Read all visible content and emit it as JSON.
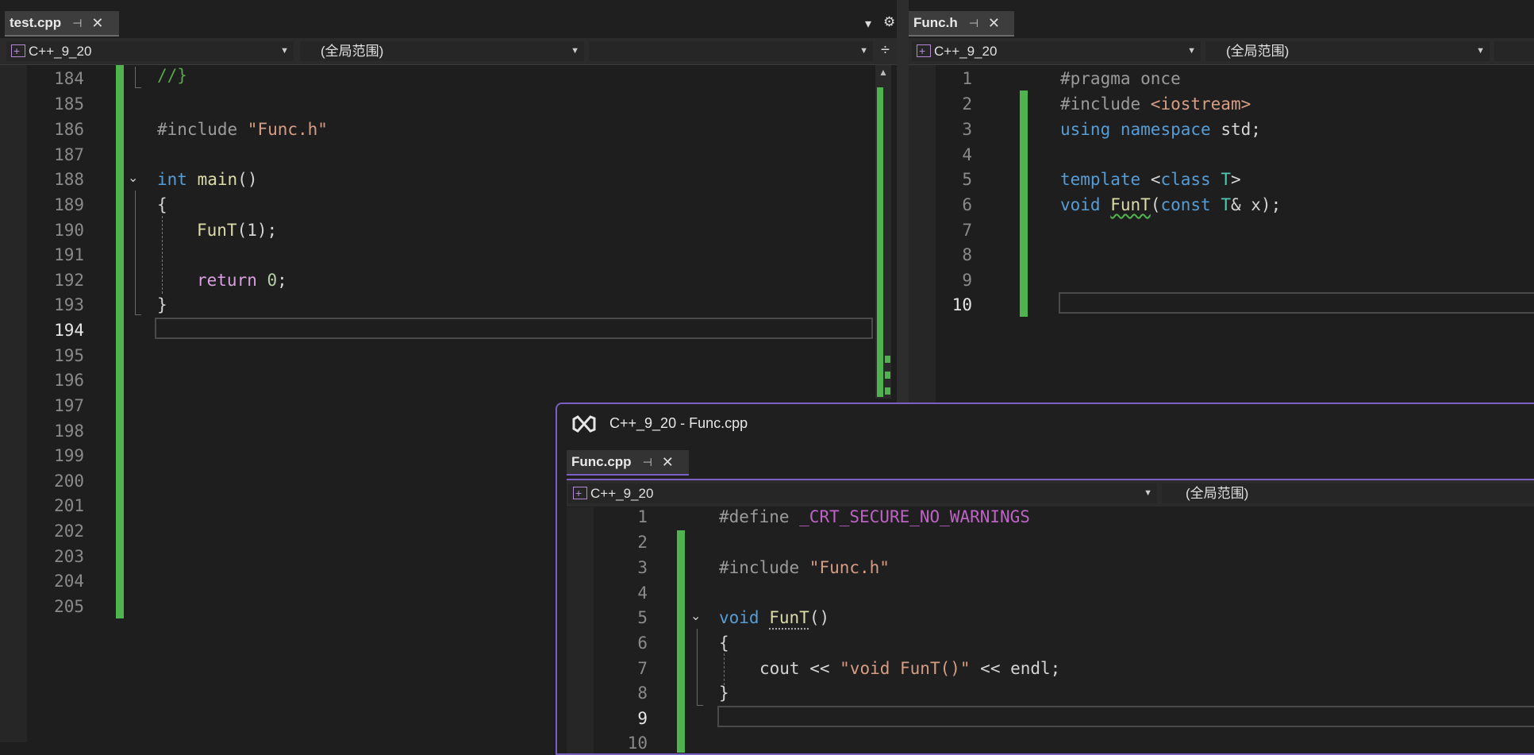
{
  "left_pane": {
    "tab": {
      "label": "test.cpp",
      "pin": "⊣",
      "close": "✕"
    },
    "nav": {
      "project": "C++_9_20",
      "scope": "(全局范围)",
      "member": ""
    },
    "lines": [
      "184",
      "185",
      "186",
      "187",
      "188",
      "189",
      "190",
      "191",
      "192",
      "193",
      "194",
      "195",
      "196",
      "197",
      "198",
      "199",
      "200",
      "201",
      "202",
      "203",
      "204",
      "205"
    ],
    "current_line": "194",
    "code": {
      "l184": "//}",
      "l186_pre": "#include ",
      "l186_str": "\"Func.h\"",
      "l188_kw": "int",
      "l188_fn": "main",
      "l188_rest": "()",
      "l189": "{",
      "l190_fn": "FunT",
      "l190_rest": "(1);",
      "l192_kw": "return",
      "l192_num": "0",
      "l192_rest": ";",
      "l193": "}"
    }
  },
  "right_pane": {
    "tab": {
      "label": "Func.h",
      "pin": "⊣",
      "close": "✕"
    },
    "nav": {
      "project": "C++_9_20",
      "scope": "(全局范围)"
    },
    "lines": [
      "1",
      "2",
      "3",
      "4",
      "5",
      "6",
      "7",
      "8",
      "9",
      "10"
    ],
    "current_line": "10",
    "code": {
      "l1": "#pragma once",
      "l2_pre": "#include ",
      "l2_str": "<iostream>",
      "l3_kw1": "using",
      "l3_kw2": "namespace",
      "l3_rest": "std;",
      "l5_kw": "template",
      "l5_a": "<",
      "l5_kw2": "class",
      "l5_ty": "T",
      "l5_b": ">",
      "l6_kw": "void",
      "l6_fn": "FunT",
      "l6_a": "(",
      "l6_kw2": "const",
      "l6_ty": "T",
      "l6_rest": "& x);"
    }
  },
  "float_window": {
    "title": "C++_9_20 - Func.cpp",
    "tab": {
      "label": "Func.cpp",
      "pin": "⊣",
      "close": "✕"
    },
    "nav": {
      "project": "C++_9_20",
      "scope": "(全局范围)"
    },
    "lines": [
      "1",
      "2",
      "3",
      "4",
      "5",
      "6",
      "7",
      "8",
      "9",
      "10"
    ],
    "current_line": "9",
    "code": {
      "l1_pre": "#define ",
      "l1_mac": "_CRT_SECURE_NO_WARNINGS",
      "l3_pre": "#include ",
      "l3_str": "\"Func.h\"",
      "l5_kw": "void",
      "l5_fn": "FunT",
      "l5_rest": "()",
      "l6": "{",
      "l7_a": "cout << ",
      "l7_str": "\"void FunT()\"",
      "l7_b": " << endl;",
      "l8": "}"
    }
  },
  "toolbar": {
    "dropdown_icon": "▾",
    "gear_icon": "⚙",
    "split_icon": "÷"
  },
  "colors": {
    "background": "#1e1e1e",
    "change_bar": "#4fb34f",
    "float_border": "#7a5fc4"
  }
}
